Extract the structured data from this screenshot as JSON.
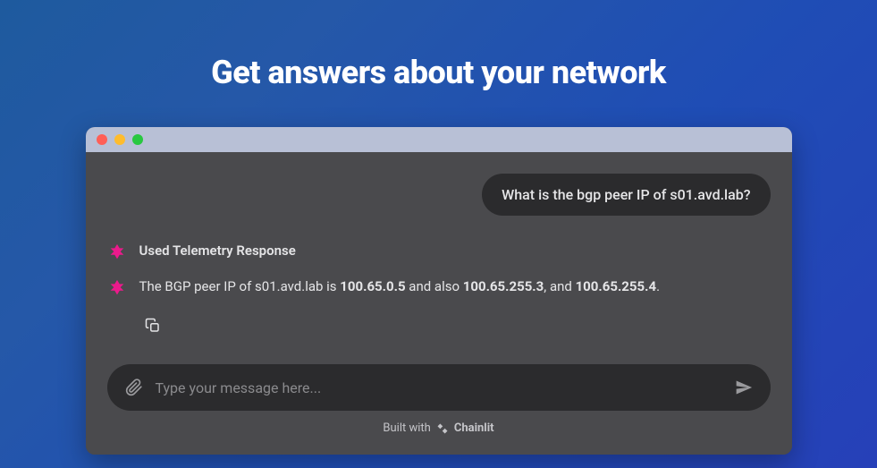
{
  "header": {
    "title": "Get answers about your network"
  },
  "chat": {
    "user_message": "What is the bgp peer IP of s01.avd.lab?",
    "used_tool_label": "Used Telemetry Response",
    "response": {
      "prefix": "The BGP peer IP of s01.avd.lab is ",
      "ip1": "100.65.0.5",
      "mid1": " and also ",
      "ip2": "100.65.255.3",
      "mid2": ", and ",
      "ip3": "100.65.255.4",
      "suffix": "."
    }
  },
  "input": {
    "placeholder": "Type your message here..."
  },
  "footer": {
    "built_with": "Built with",
    "brand": "Chainlit"
  }
}
